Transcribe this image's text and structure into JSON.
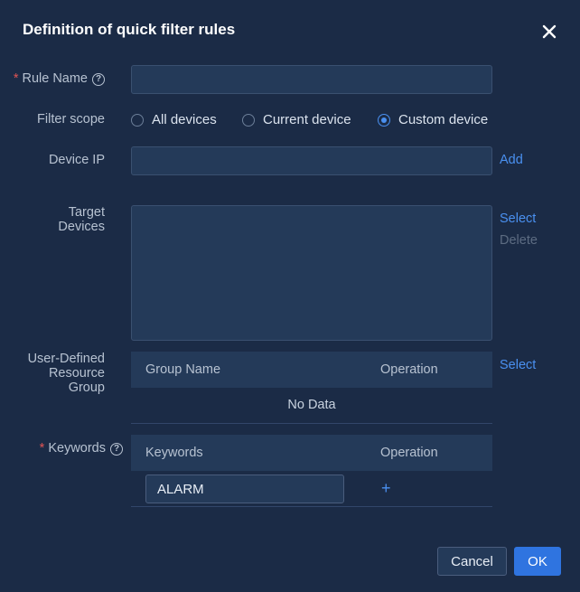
{
  "dialog": {
    "title": "Definition of quick filter rules"
  },
  "form": {
    "rule_name": {
      "label": "Rule Name",
      "required": "*",
      "value": ""
    },
    "filter_scope": {
      "label": "Filter scope",
      "options": [
        "All devices",
        "Current device",
        "Custom device"
      ],
      "selected": "Custom device"
    },
    "device_ip": {
      "label": "Device IP",
      "value": "",
      "add_label": "Add"
    },
    "target_devices": {
      "label_line1": "Target",
      "label_line2": "Devices",
      "select_label": "Select",
      "delete_label": "Delete"
    },
    "resource_group": {
      "label_line1": "User-Defined",
      "label_line2": "Resource",
      "label_line3": "Group",
      "columns": [
        "Group Name",
        "Operation"
      ],
      "empty_text": "No Data",
      "select_label": "Select"
    },
    "keywords": {
      "label": "Keywords",
      "required": "*",
      "columns": [
        "Keywords",
        "Operation"
      ],
      "rows": [
        {
          "value": "ALARM"
        }
      ],
      "add_symbol": "+"
    }
  },
  "footer": {
    "cancel_label": "Cancel",
    "ok_label": "OK"
  },
  "colors": {
    "background": "#1b2b46",
    "accent": "#2f74e0",
    "link": "#4a90f0",
    "required": "#e05454"
  }
}
